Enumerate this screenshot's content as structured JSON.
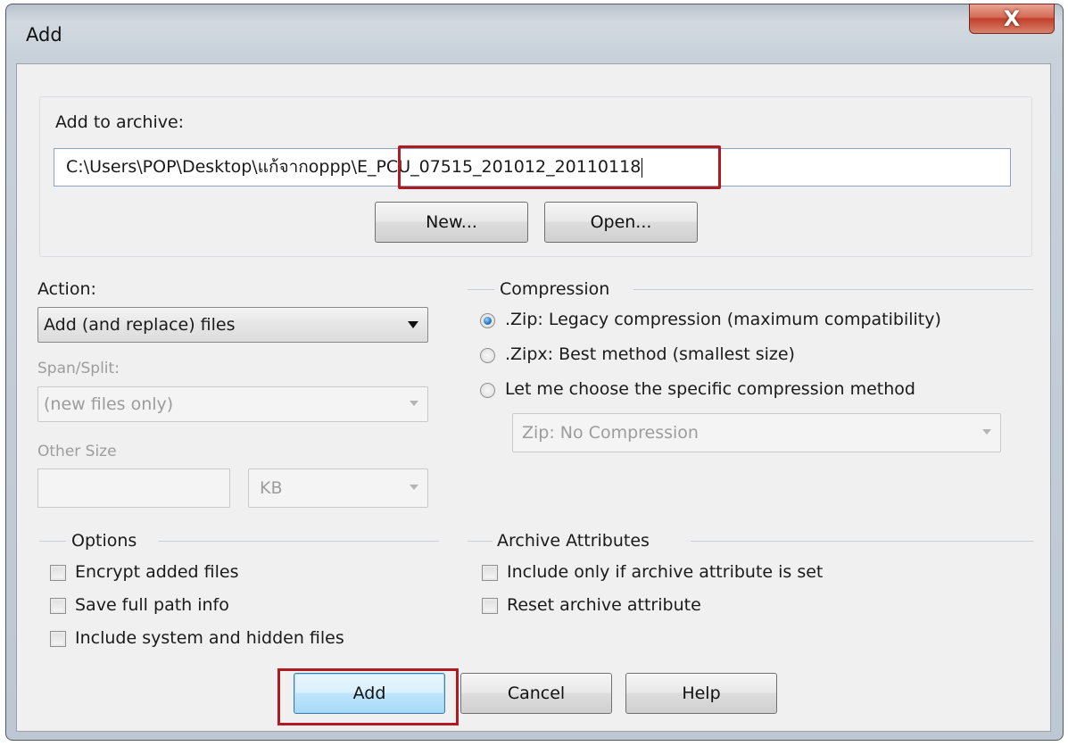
{
  "window": {
    "title": "Add",
    "close_glyph": "X"
  },
  "archive": {
    "label": "Add to archive:",
    "path_value": "C:\\Users\\POP\\Desktop\\แก้จากoppp\\E_PCU_07515_201012_20110118",
    "new_button": "New...",
    "open_button": "Open..."
  },
  "action": {
    "label": "Action:",
    "selected": "Add (and replace) files",
    "span_label": "Span/Split:",
    "span_selected": "(new files only)",
    "other_size_label": "Other Size",
    "size_value": "",
    "unit_selected": "KB"
  },
  "compression": {
    "title": "Compression",
    "options": [
      {
        "label": ".Zip: Legacy compression (maximum compatibility)",
        "checked": true
      },
      {
        "label": ".Zipx: Best method (smallest size)",
        "checked": false
      },
      {
        "label": "Let me choose the specific compression method",
        "checked": false
      }
    ],
    "method_selected": "Zip: No Compression"
  },
  "options": {
    "title": "Options",
    "items": [
      {
        "label": "Encrypt added files",
        "checked": false
      },
      {
        "label": "Save full path info",
        "checked": false
      },
      {
        "label": "Include system and hidden files",
        "checked": false
      }
    ]
  },
  "attributes": {
    "title": "Archive Attributes",
    "items": [
      {
        "label": "Include only if archive attribute is set",
        "checked": false
      },
      {
        "label": "Reset archive attribute",
        "checked": false
      }
    ]
  },
  "buttons": {
    "add": "Add",
    "cancel": "Cancel",
    "help": "Help"
  },
  "colors": {
    "highlight": "#b01b22",
    "default_button": "#bee6fd",
    "close_button": "#c2402b"
  }
}
